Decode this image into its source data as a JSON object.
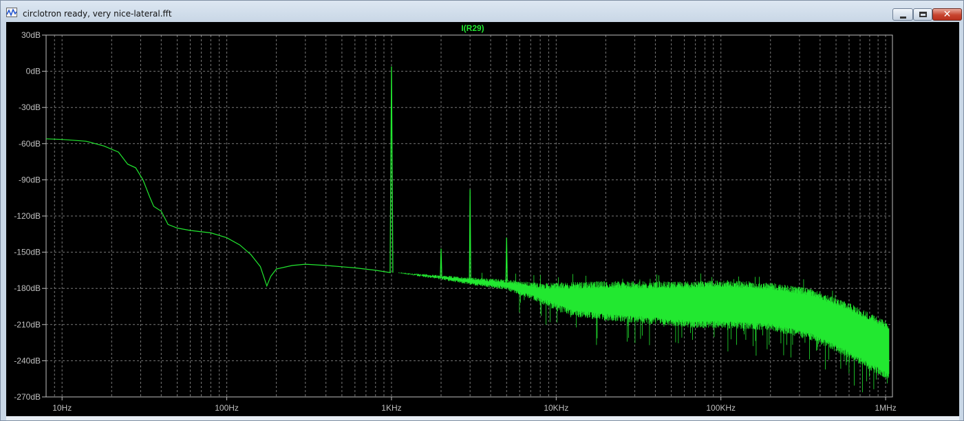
{
  "window": {
    "title": "circlotron ready, very nice-lateral.fft",
    "minimize_icon": "minimize-icon",
    "maximize_icon": "maximize-icon",
    "close_icon": "close-icon",
    "close_glyph": "✕"
  },
  "colors": {
    "background": "#000000",
    "grid": "#7a7a7a",
    "trace": "#22e830",
    "labels": "#c0c0c0"
  },
  "chart_data": {
    "type": "line",
    "title": "I(R29)",
    "xscale": "log",
    "xlim": [
      8,
      1100000
    ],
    "ylim": [
      -270,
      30
    ],
    "y_ticks": [
      30,
      0,
      -30,
      -60,
      -90,
      -120,
      -150,
      -180,
      -210,
      -240,
      -270
    ],
    "y_tick_labels": [
      "30dB",
      "0dB",
      "-30dB",
      "-60dB",
      "-90dB",
      "-120dB",
      "-150dB",
      "-180dB",
      "-210dB",
      "-240dB",
      "-270dB"
    ],
    "x_ticks": [
      10,
      100,
      1000,
      10000,
      100000,
      1000000
    ],
    "x_tick_labels": [
      "10Hz",
      "100Hz",
      "1KHz",
      "10KHz",
      "100KHz",
      "1MHz"
    ],
    "grid": true,
    "series": [
      {
        "name": "I(R29)",
        "color": "#22e830",
        "smooth_points": [
          [
            8,
            -56
          ],
          [
            10,
            -56.5
          ],
          [
            14,
            -58
          ],
          [
            18,
            -62
          ],
          [
            22,
            -67
          ],
          [
            25,
            -77
          ],
          [
            28,
            -80
          ],
          [
            31,
            -90
          ],
          [
            34,
            -104
          ],
          [
            36,
            -112
          ],
          [
            40,
            -116
          ],
          [
            44,
            -127
          ],
          [
            50,
            -130
          ],
          [
            60,
            -132
          ],
          [
            80,
            -134
          ],
          [
            100,
            -138
          ],
          [
            120,
            -144
          ],
          [
            140,
            -152
          ],
          [
            160,
            -162
          ],
          [
            175,
            -178
          ],
          [
            185,
            -170
          ],
          [
            200,
            -164
          ],
          [
            250,
            -161
          ],
          [
            300,
            -160
          ],
          [
            400,
            -161
          ],
          [
            600,
            -163
          ],
          [
            800,
            -165
          ],
          [
            990,
            -167
          ]
        ],
        "spikes": [
          {
            "x": 1000,
            "y": 4
          },
          {
            "x": 2000,
            "y": -147
          },
          {
            "x": 3000,
            "y": -98
          },
          {
            "x": 5000,
            "y": -138
          }
        ],
        "noise_band": [
          [
            1100,
            -167,
            -167
          ],
          [
            2000,
            -170,
            -172
          ],
          [
            3000,
            -172,
            -176
          ],
          [
            5000,
            -174,
            -180
          ],
          [
            8000,
            -178,
            -190
          ],
          [
            12000,
            -178,
            -200
          ],
          [
            20000,
            -177,
            -204
          ],
          [
            40000,
            -177,
            -207
          ],
          [
            70000,
            -177,
            -210
          ],
          [
            100000,
            -176,
            -210
          ],
          [
            200000,
            -178,
            -212
          ],
          [
            350000,
            -183,
            -220
          ],
          [
            600000,
            -195,
            -235
          ],
          [
            1000000,
            -210,
            -252
          ],
          [
            1050000,
            -212,
            -253
          ]
        ]
      }
    ]
  }
}
